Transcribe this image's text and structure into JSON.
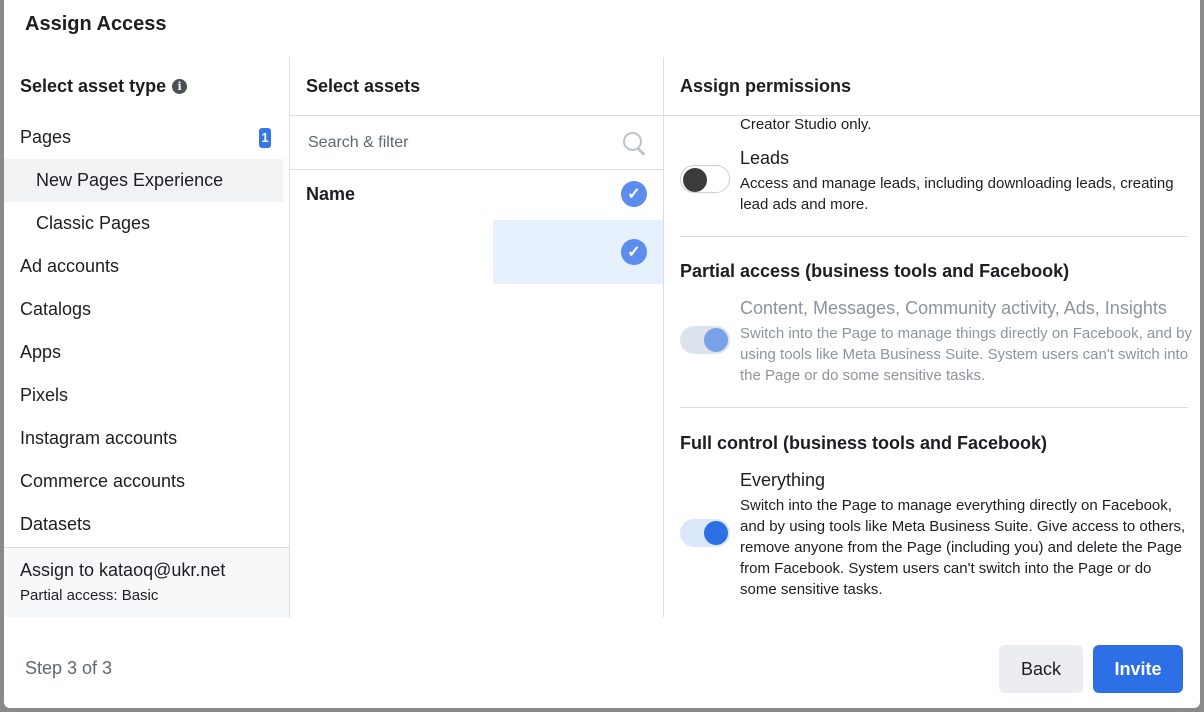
{
  "dialog": {
    "title": "Assign Access"
  },
  "asset_type": {
    "heading": "Select asset type",
    "info_icon": "info-icon",
    "items": [
      {
        "label": "Pages",
        "badge": "1"
      },
      {
        "label": "New Pages Experience"
      },
      {
        "label": "Classic Pages"
      },
      {
        "label": "Ad accounts"
      },
      {
        "label": "Catalogs"
      },
      {
        "label": "Apps"
      },
      {
        "label": "Pixels"
      },
      {
        "label": "Instagram accounts"
      },
      {
        "label": "Commerce accounts"
      },
      {
        "label": "Datasets"
      }
    ],
    "assign_to": "Assign to kataoq@ukr.net",
    "assign_sub": "Partial access: Basic"
  },
  "assets": {
    "heading": "Select assets",
    "search_placeholder": "Search & filter",
    "search_icon": "search-icon",
    "name_header": "Name"
  },
  "permissions": {
    "heading": "Assign permissions",
    "cut_text": "Creator Studio only.",
    "leads": {
      "title": "Leads",
      "desc": "Access and manage leads, including downloading leads, creating lead ads and more.",
      "enabled": false
    },
    "partial": {
      "heading": "Partial access (business tools and Facebook)",
      "title": "Content, Messages, Community activity, Ads, Insights",
      "desc": "Switch into the Page to manage things directly on Facebook, and by using tools like Meta Business Suite. System users can't switch into the Page or do some sensitive tasks.",
      "enabled": true,
      "disabled": true
    },
    "full": {
      "heading": "Full control (business tools and Facebook)",
      "title": "Everything",
      "desc": "Switch into the Page to manage everything directly on Facebook, and by using tools like Meta Business Suite. Give access to others, remove anyone from the Page (including you) and delete the Page from Facebook. System users can't switch into the Page or do some sensitive tasks.",
      "enabled": true
    }
  },
  "footer": {
    "step": "Step 3 of 3",
    "back_label": "Back",
    "invite_label": "Invite"
  },
  "colors": {
    "primary": "#2d6fe4",
    "selected_row": "#e7f0fd",
    "check": "#5b8def"
  }
}
